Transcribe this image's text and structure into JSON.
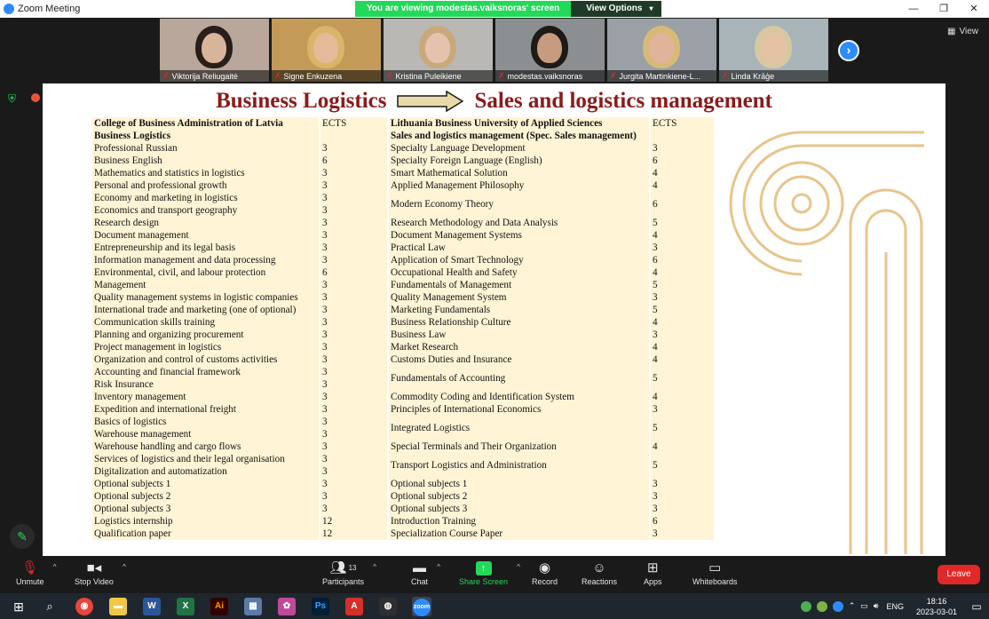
{
  "window": {
    "title": "Zoom Meeting"
  },
  "banner": {
    "message": "You are viewing modestas.vaiksnoras' screen",
    "view_options": "View Options"
  },
  "view_button": "View",
  "participants": [
    {
      "name": "Viktorija Reliugaitė",
      "bg": "#b9a79b",
      "skin": "#d8b49b",
      "hair": "#2a1e1a"
    },
    {
      "name": "Signe Enkuzena",
      "bg": "#c49a58",
      "skin": "#e3bb98",
      "hair": "#d9b46a"
    },
    {
      "name": "Kristina Puleikiene",
      "bg": "#b9b8b4",
      "skin": "#e4c3ae",
      "hair": "#c9a97c"
    },
    {
      "name": "modestas.vaiksnoras",
      "bg": "#8c8f91",
      "skin": "#c79b80",
      "hair": "#1d1a17"
    },
    {
      "name": "Jurgita Martinkiene-L...",
      "bg": "#9aa0a6",
      "skin": "#e0b49a",
      "hair": "#d7ba78"
    },
    {
      "name": "Linda Krāģe",
      "bg": "#a9b4b9",
      "skin": "#e6c2a4",
      "hair": "#d8c8a2"
    }
  ],
  "slide": {
    "title_left": "Business Logistics",
    "title_right": "Sales and logistics management",
    "accent_color": "#8b1a1a",
    "cell_color": "#fff5d6",
    "header": {
      "left_college": "College of Business Administration of Latvia",
      "ects_left": "ECTS",
      "right_college": "Lithuania Business University of Applied Sciences",
      "ects_right": "ECTS"
    },
    "subheader": {
      "left": "Business Logistics",
      "right": "Sales and logistics management (Spec. Sales management)"
    },
    "rows": [
      {
        "left": "Professional Russian",
        "lects": "3",
        "right": "Specialty Language Development",
        "rects": "3"
      },
      {
        "left": "Business English",
        "lects": "6",
        "right": "Specialty Foreign Language (English)",
        "rects": "6"
      },
      {
        "left": "Mathematics and statistics in logistics",
        "lects": "3",
        "right": "Smart Mathematical Solution",
        "rects": "4"
      },
      {
        "left": "Personal and professional growth",
        "lects": "3",
        "right": "Applied Management Philosophy",
        "rects": "4"
      },
      {
        "left": "Economy and marketing in logistics",
        "lects": "3",
        "right": "Modern Economy Theory",
        "rects": "6",
        "span": 2
      },
      {
        "left": "Economics and transport geography",
        "lects": "3"
      },
      {
        "left": "Research design",
        "lects": "3",
        "right": "Research Methodology and Data Analysis",
        "rects": "5"
      },
      {
        "left": "Document management",
        "lects": "3",
        "right": "Document Management Systems",
        "rects": "4"
      },
      {
        "left": "Entrepreneurship and its legal basis",
        "lects": "3",
        "right": "Practical Law",
        "rects": "3"
      },
      {
        "left": "Information management and data processing",
        "lects": "3",
        "right": "Application of Smart Technology",
        "rects": "6"
      },
      {
        "left": "Environmental, civil, and labour protection",
        "lects": "6",
        "right": "Occupational Health and Safety",
        "rects": "4"
      },
      {
        "left": "Management",
        "lects": "3",
        "right": "Fundamentals of Management",
        "rects": "5"
      },
      {
        "left": "Quality management systems in logistic companies",
        "lects": "3",
        "right": "Quality Management System",
        "rects": "3"
      },
      {
        "left": "International trade and marketing (one of optional)",
        "lects": "3",
        "right": "Marketing Fundamentals",
        "rects": "5"
      },
      {
        "left": "Communication skills training",
        "lects": "3",
        "right": "Business Relationship Culture",
        "rects": "4"
      },
      {
        "left": "Planning and organizing procurement",
        "lects": "3",
        "right": "Business Law",
        "rects": "3"
      },
      {
        "left": "Project management in logistics",
        "lects": "3",
        "right": "Market Research",
        "rects": "4"
      },
      {
        "left": "Organization and control of customs activities",
        "lects": "3",
        "right": "Customs Duties  and Insurance",
        "rects": "4"
      },
      {
        "left": "Accounting and financial framework",
        "lects": "3",
        "right": "Fundamentals of Accounting",
        "rects": "5",
        "span": 2
      },
      {
        "left": "Risk Insurance",
        "lects": "3"
      },
      {
        "left": "Inventory management",
        "lects": "3",
        "right": "Commodity Coding and Identification System",
        "rects": "4"
      },
      {
        "left": "Expedition and international freight",
        "lects": "3",
        "right": "Principles of International Economics",
        "rects": "3"
      },
      {
        "left": "Basics of logistics",
        "lects": "3",
        "right": "Integrated Logistics",
        "rects": "5",
        "span": 2
      },
      {
        "left": "Warehouse management",
        "lects": "3"
      },
      {
        "left": "Warehouse handling and cargo flows",
        "lects": "3",
        "right": "Special Terminals and Their Organization",
        "rects": "4"
      },
      {
        "left": "Services of logistics and their legal organisation",
        "lects": "3",
        "right": "Transport Logistics and Administration",
        "rects": "5",
        "span": 2
      },
      {
        "left": "Digitalization and automatization",
        "lects": "3"
      },
      {
        "left": "Optional subjects 1",
        "lects": "3",
        "right": "Optional subjects 1",
        "rects": "3"
      },
      {
        "left": "Optional subjects 2",
        "lects": "3",
        "right": "Optional subjects 2",
        "rects": "3"
      },
      {
        "left": "Optional subjects 3",
        "lects": "3",
        "right": "Optional subjects 3",
        "rects": "3"
      },
      {
        "left": "Logistics internship",
        "lects": "12",
        "right": "Introduction Training",
        "rects": "6"
      },
      {
        "left": "Qualification paper",
        "lects": "12",
        "right": "Specialization Course Paper",
        "rects": "3"
      }
    ]
  },
  "toolbar": {
    "unmute": "Unmute",
    "stop_video": "Stop Video",
    "participants": "Participants",
    "participants_count": "13",
    "chat": "Chat",
    "share_screen": "Share Screen",
    "record": "Record",
    "reactions": "Reactions",
    "apps": "Apps",
    "whiteboards": "Whiteboards",
    "leave": "Leave"
  },
  "taskbar": {
    "language": "ENG",
    "time": "18:16",
    "date": "2023-03-01",
    "apps": [
      {
        "name": "chrome",
        "glyph": "◉",
        "color": "#e8453c"
      },
      {
        "name": "file-explorer",
        "glyph": "▬",
        "color": "#f2c744"
      },
      {
        "name": "word",
        "glyph": "W",
        "color": "#2b579a"
      },
      {
        "name": "excel",
        "glyph": "X",
        "color": "#217346"
      },
      {
        "name": "illustrator",
        "glyph": "Ai",
        "color": "#330000"
      },
      {
        "name": "calculator",
        "glyph": "▦",
        "color": "#5a7aa8"
      },
      {
        "name": "photos",
        "glyph": "✿",
        "color": "#c04a9a"
      },
      {
        "name": "photoshop",
        "glyph": "Ps",
        "color": "#001e36"
      },
      {
        "name": "acrobat",
        "glyph": "A",
        "color": "#d4302a"
      },
      {
        "name": "obs",
        "glyph": "◍",
        "color": "#302e31"
      },
      {
        "name": "zoom",
        "glyph": "zoom",
        "color": "#2d8cff"
      }
    ]
  }
}
